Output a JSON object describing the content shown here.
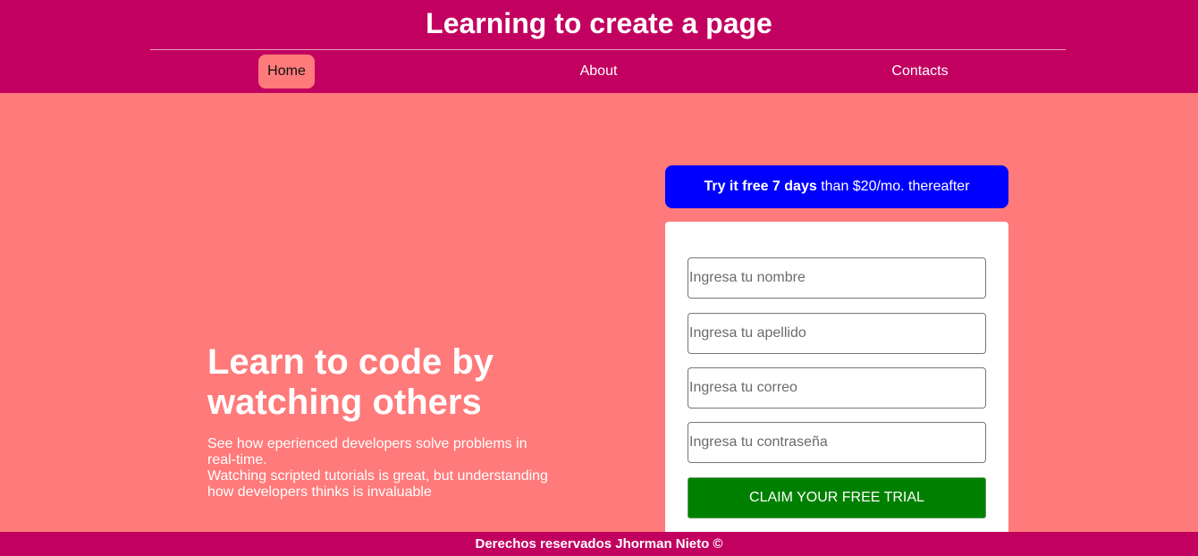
{
  "header": {
    "title": "Learning to create a page",
    "nav": [
      {
        "label": "Home",
        "active": true
      },
      {
        "label": "About",
        "active": false
      },
      {
        "label": "Contacts",
        "active": false
      }
    ]
  },
  "hero": {
    "title": "Learn to code by watching others",
    "description_lines": [
      "See how eperienced developers solve problems in real-time.",
      "Watching scripted tutorials is great, but understanding how developers thinks is invaluable"
    ]
  },
  "promo": {
    "bold": "Try it free 7 days",
    "rest": " than $20/mo. thereafter"
  },
  "form": {
    "fields": [
      {
        "placeholder": "Ingresa tu nombre"
      },
      {
        "placeholder": "Ingresa tu apellido"
      },
      {
        "placeholder": "Ingresa tu correo"
      },
      {
        "placeholder": "Ingresa tu contraseña"
      }
    ],
    "submit_label": "Claim your free trial"
  },
  "footer": {
    "text": "Derechos reservados Jhorman Nieto ©"
  },
  "colors": {
    "header_bg": "#c20060",
    "page_bg": "#ff7a7a",
    "promo_bg": "#0000ff",
    "submit_bg": "#008000"
  }
}
